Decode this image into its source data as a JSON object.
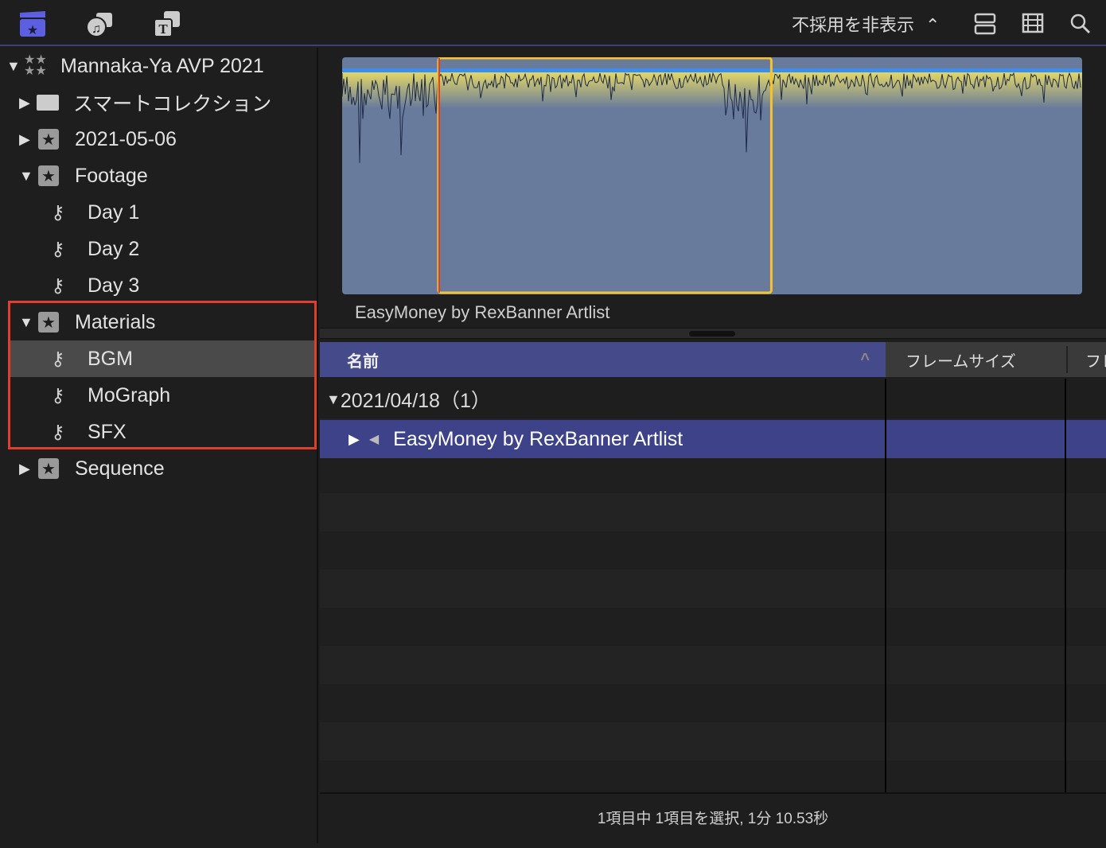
{
  "toolbar": {
    "filter_label": "不採用を非表示",
    "icons": [
      "libraries-icon",
      "photos-audio-icon",
      "titles-generators-icon",
      "clip-appearance-icon",
      "filmstrip-icon",
      "search-icon"
    ]
  },
  "sidebar": {
    "items": [
      {
        "label": "Mannaka-Ya AVP 2021",
        "type": "library",
        "expanded": true
      },
      {
        "label": "スマートコレクション",
        "type": "folder",
        "expanded": false
      },
      {
        "label": "2021-05-06",
        "type": "event",
        "expanded": false
      },
      {
        "label": "Footage",
        "type": "event",
        "expanded": true
      },
      {
        "label": "Day 1",
        "type": "keyword"
      },
      {
        "label": "Day 2",
        "type": "keyword"
      },
      {
        "label": "Day 3",
        "type": "keyword"
      },
      {
        "label": "Materials",
        "type": "event",
        "expanded": true
      },
      {
        "label": "BGM",
        "type": "keyword",
        "selected": true
      },
      {
        "label": "MoGraph",
        "type": "keyword"
      },
      {
        "label": "SFX",
        "type": "keyword"
      },
      {
        "label": "Sequence",
        "type": "event",
        "expanded": false
      }
    ]
  },
  "viewer": {
    "clip_name": "EasyMoney by RexBanner Artlist",
    "selection_range": [
      0.13,
      0.58
    ]
  },
  "table": {
    "columns": [
      "名前",
      "フレームサイズ",
      "フレ"
    ],
    "group": "2021/04/18（1）",
    "rows": [
      {
        "name": "EasyMoney by RexBanner Artlist"
      }
    ]
  },
  "status": "1項目中 1項目を選択, 1分 10.53秒",
  "colors": {
    "accent": "#444a8a",
    "selection_yellow": "#f4c430",
    "highlight_red": "#e0402a"
  }
}
